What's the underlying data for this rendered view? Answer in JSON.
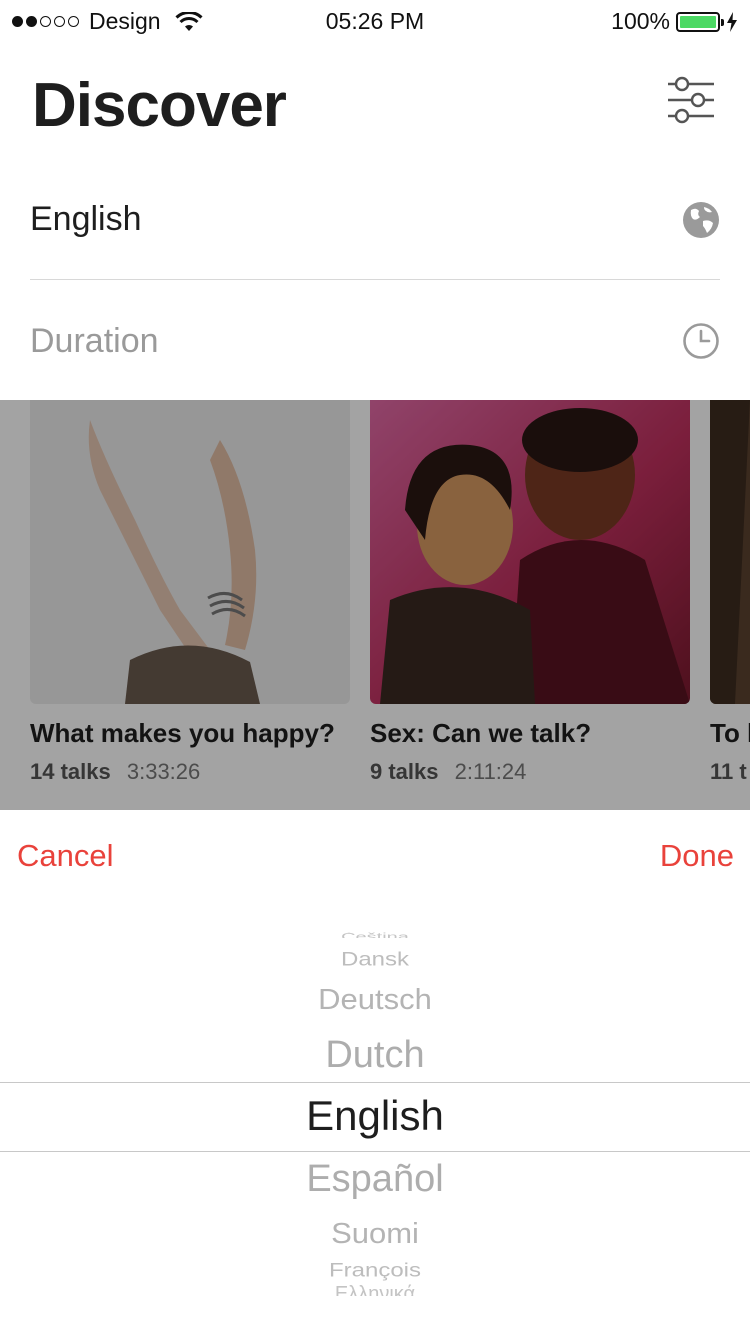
{
  "status_bar": {
    "carrier": "Design",
    "time": "05:26 PM",
    "battery": "100%",
    "signal_bars": 2,
    "battery_level": 1.0,
    "battery_color": "#4cd964"
  },
  "header": {
    "title": "Discover",
    "filter_icon": "sliders-icon"
  },
  "filters": {
    "language": {
      "label": "English",
      "icon": "globe-icon"
    },
    "duration": {
      "placeholder": "Duration",
      "icon": "clock-icon"
    }
  },
  "cards": [
    {
      "title": "What makes you happy?",
      "talks": "14 talks",
      "duration": "3:33:26"
    },
    {
      "title": "Sex: Can we talk?",
      "talks": "9 talks",
      "duration": "2:11:24"
    },
    {
      "title": "To l",
      "talks": "11 t",
      "duration": ""
    }
  ],
  "picker": {
    "cancel_label": "Cancel",
    "done_label": "Done",
    "accent_color": "#e9423b",
    "options": [
      "Čeština",
      "Dansk",
      "Deutsch",
      "Dutch",
      "English",
      "Español",
      "Suomi",
      "François",
      "Ελληνικά"
    ],
    "selected": "English"
  }
}
